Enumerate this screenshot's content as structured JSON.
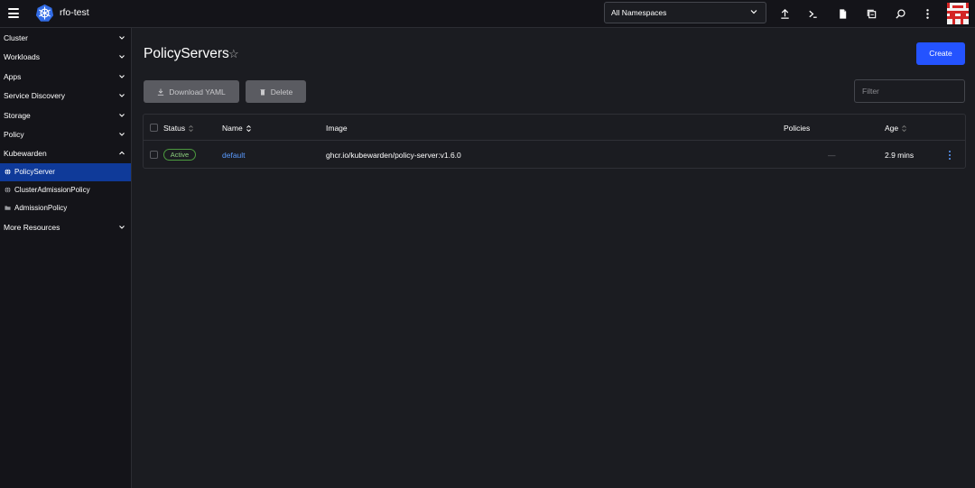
{
  "header": {
    "cluster_name": "rfo-test",
    "namespace_select": "All Namespaces",
    "icons": [
      "upload-icon",
      "terminal-icon",
      "file-icon",
      "copy-icon",
      "search-icon",
      "more-vert-icon"
    ]
  },
  "sidebar": {
    "groups": [
      {
        "label": "Cluster",
        "expanded": false
      },
      {
        "label": "Workloads",
        "expanded": false
      },
      {
        "label": "Apps",
        "expanded": false
      },
      {
        "label": "Service Discovery",
        "expanded": false
      },
      {
        "label": "Storage",
        "expanded": false
      },
      {
        "label": "Policy",
        "expanded": false
      },
      {
        "label": "Kubewarden",
        "expanded": true
      }
    ],
    "kubewarden_items": [
      {
        "label": "PolicyServer",
        "active": true,
        "icon": "globe-icon"
      },
      {
        "label": "ClusterAdmissionPolicy",
        "active": false,
        "icon": "globe-icon"
      },
      {
        "label": "AdmissionPolicy",
        "active": false,
        "icon": "folder-icon"
      }
    ],
    "more": {
      "label": "More Resources",
      "expanded": false
    }
  },
  "main": {
    "title": "PolicyServers",
    "create_label": "Create",
    "download_label": "Download YAML",
    "delete_label": "Delete",
    "filter_placeholder": "Filter",
    "table": {
      "headers": {
        "status": "Status",
        "name": "Name",
        "image": "Image",
        "policies": "Policies",
        "age": "Age"
      },
      "rows": [
        {
          "status": "Active",
          "name": "default",
          "image": "ghcr.io/kubewarden/policy-server:v1.6.0",
          "policies": "—",
          "age": "2.9 mins"
        }
      ]
    }
  },
  "colors": {
    "background": "#1b1c21",
    "sidebar": "#141419",
    "accent": "#2453ff",
    "active_nav": "#0f3a99",
    "link": "#5a9bff",
    "active_badge": "#4c9a3f"
  }
}
